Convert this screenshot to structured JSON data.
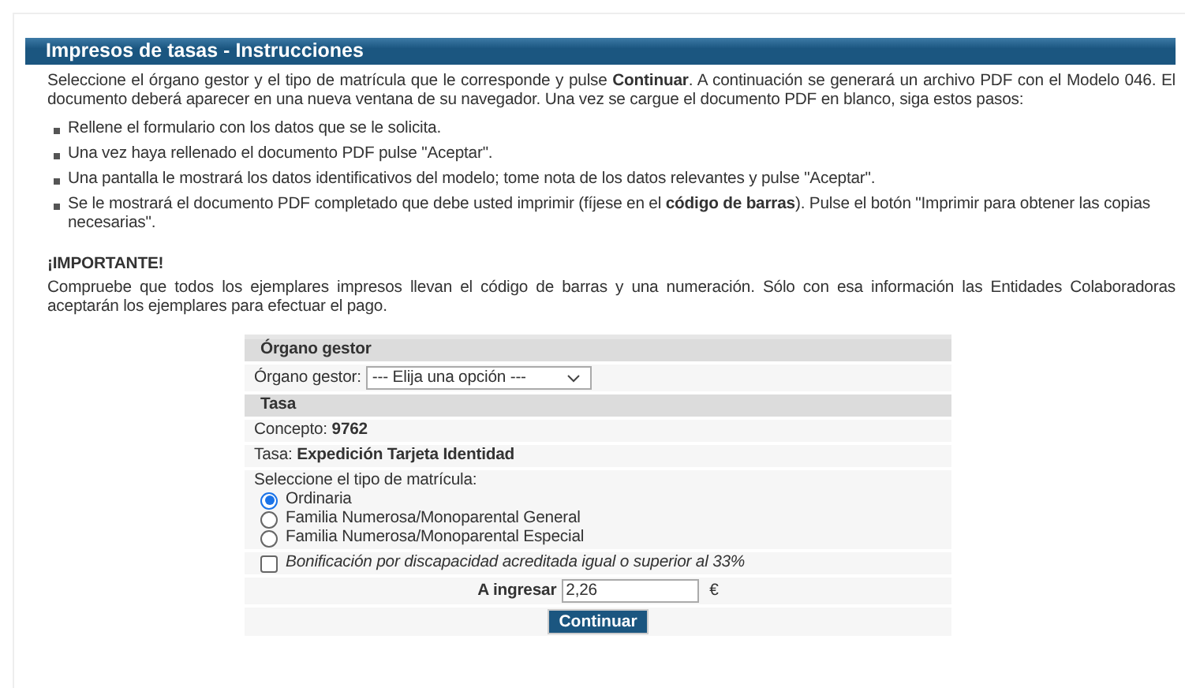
{
  "header": {
    "title": "Impresos de tasas - Instrucciones"
  },
  "intro": "Seleccione el órgano gestor y el tipo de matrícula que le corresponde y pulse **Continuar**. A continuación se generará un archivo PDF con el Modelo 046. El documento deberá aparecer en una nueva ventana de su navegador. Una vez se cargue el documento PDF en blanco, siga estos pasos:",
  "steps": [
    "Rellene el formulario con los datos que se le solicita.",
    "Una vez haya rellenado el documento PDF pulse \"Aceptar\".",
    "Una pantalla le mostrará los datos identificativos del modelo; tome nota de los datos relevantes y pulse \"Aceptar\".",
    "Se le mostrará el documento PDF completado que debe usted imprimir (fíjese en el **código de barras**). Pulse el botón \"Imprimir para obtener las copias necesarias\"."
  ],
  "important": {
    "heading": "¡IMPORTANTE!",
    "text": "Compruebe que todos los ejemplares impresos llevan el código de barras y una numeración. Sólo con esa información las Entidades Colaboradoras aceptarán los ejemplares para efectuar el pago."
  },
  "form": {
    "organ_section": "Órgano gestor",
    "organ_label": "Órgano gestor:",
    "organ_select": "--- Elija una opción ---",
    "fee_section": "Tasa",
    "concept_label": "Concepto:",
    "concept_value": "9762",
    "fee_label": "Tasa:",
    "fee_value": "Expedición Tarjeta Identidad",
    "type_label": "Seleccione el tipo de matrícula:",
    "types": [
      {
        "label": "Ordinaria",
        "selected": true
      },
      {
        "label": "Familia Numerosa/Monoparental General",
        "selected": false
      },
      {
        "label": "Familia Numerosa/Monoparental Especial",
        "selected": false
      }
    ],
    "discount": {
      "label": "Bonificación por discapacidad acreditada igual o superior al 33%",
      "checked": false
    },
    "amount_label": "A ingresar",
    "amount_value": "2,26",
    "currency": "€",
    "submit": "Continuar"
  }
}
